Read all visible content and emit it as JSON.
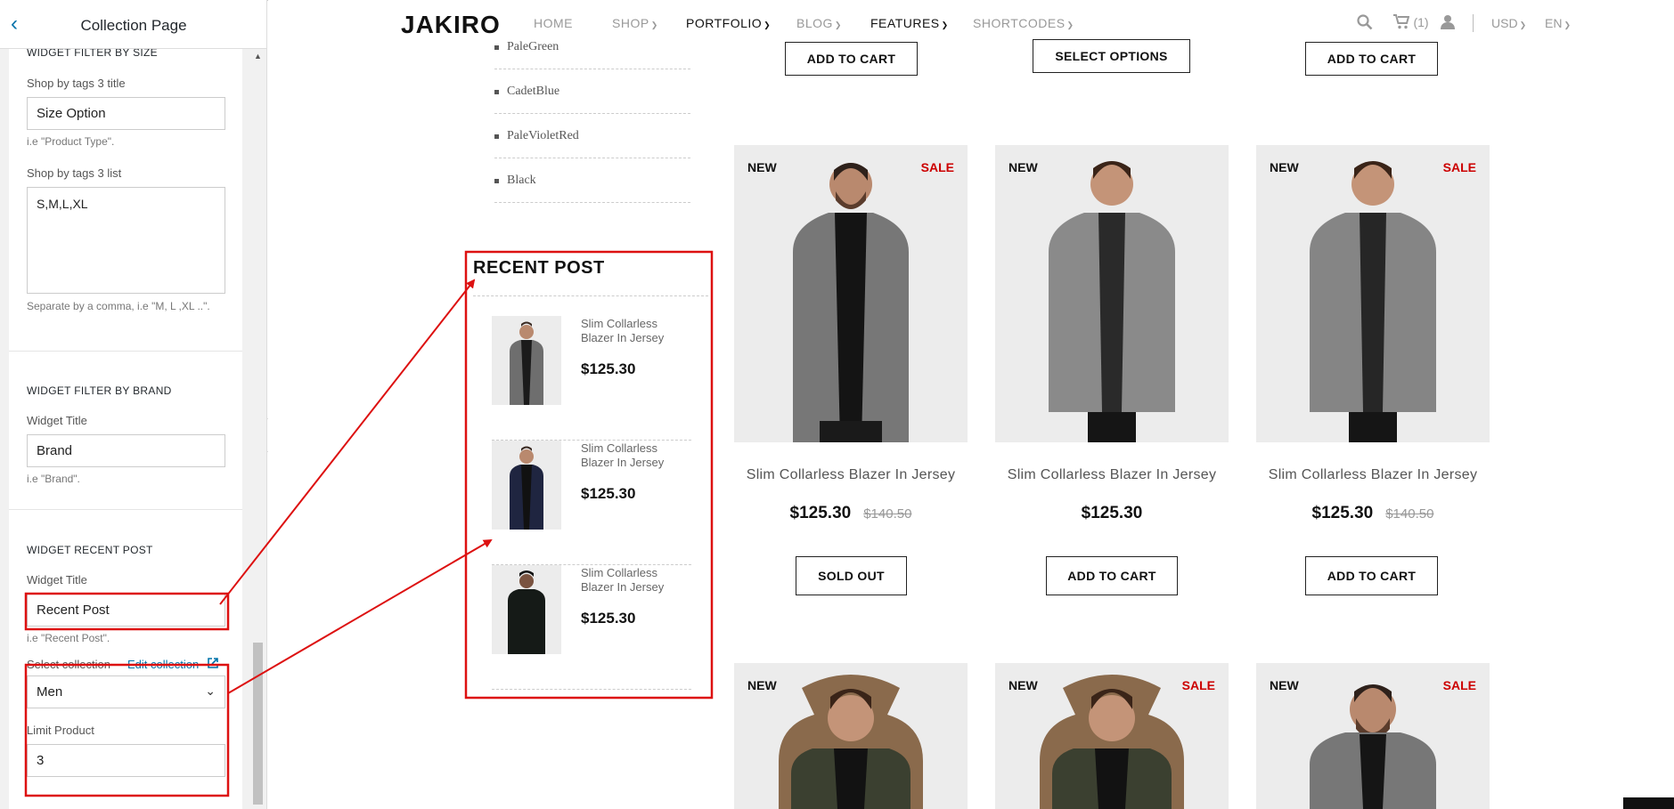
{
  "sidebar": {
    "title": "Collection Page",
    "size_section": {
      "heading": "WIDGET FILTER BY SIZE",
      "title_label": "Shop by tags 3 title",
      "title_value": "Size Option",
      "title_hint": "i.e \"Product Type\".",
      "list_label": "Shop by tags 3 list",
      "list_value": "S,M,L,XL",
      "list_hint": "Separate by a comma, i.e \"M, L ,XL ..\"."
    },
    "brand_section": {
      "heading": "WIDGET FILTER BY BRAND",
      "title_label": "Widget Title",
      "title_value": "Brand",
      "title_hint": "i.e \"Brand\"."
    },
    "recent_section": {
      "heading": "WIDGET RECENT POST",
      "title_label": "Widget Title",
      "title_value": "Recent Post",
      "title_hint": "i.e \"Recent Post\".",
      "collection_label": "Select collection",
      "edit_link": "Edit collection",
      "collection_value": "Men",
      "limit_label": "Limit Product",
      "limit_value": "3"
    }
  },
  "site": {
    "logo": "JAKIRO",
    "nav": [
      "HOME",
      "SHOP",
      "PORTFOLIO",
      "BLOG",
      "FEATURES",
      "SHORTCODES"
    ],
    "cart_count": "(1)",
    "currency": "USD",
    "language": "EN"
  },
  "colors_list": [
    "PaleGreen",
    "CadetBlue",
    "PaleVioletRed",
    "Black"
  ],
  "recent_post": {
    "title": "RECENT POST",
    "items": [
      {
        "name": "Slim Collarless Blazer In Jersey",
        "price": "$125.30"
      },
      {
        "name": "Slim Collarless Blazer In Jersey",
        "price": "$125.30"
      },
      {
        "name": "Slim Collarless Blazer In Jersey",
        "price": "$125.30"
      }
    ]
  },
  "top_buttons": [
    "ADD TO CART",
    "SELECT OPTIONS",
    "ADD TO CART"
  ],
  "products": [
    {
      "new": "NEW",
      "sale": "SALE",
      "name": "Slim Collarless Blazer In Jersey",
      "price": "$125.30",
      "old_price": "$140.50",
      "button": "SOLD OUT"
    },
    {
      "new": "NEW",
      "sale": "",
      "name": "Slim Collarless Blazer In Jersey",
      "price": "$125.30",
      "old_price": "",
      "button": "ADD TO CART"
    },
    {
      "new": "NEW",
      "sale": "SALE",
      "name": "Slim Collarless Blazer In Jersey",
      "price": "$125.30",
      "old_price": "$140.50",
      "button": "ADD TO CART"
    }
  ],
  "row2": [
    {
      "new": "NEW",
      "sale": ""
    },
    {
      "new": "NEW",
      "sale": "SALE"
    },
    {
      "new": "NEW",
      "sale": "SALE"
    }
  ],
  "colors": {
    "accent": "#0073aa",
    "annotation": "#dd1111",
    "sale": "#cc0000"
  }
}
